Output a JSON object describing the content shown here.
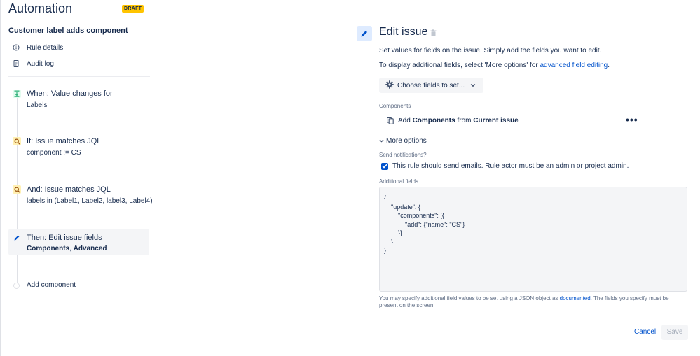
{
  "app": {
    "title": "Automation",
    "badge": "DRAFT"
  },
  "sidebar": {
    "rule_name": "Customer label adds component",
    "links": [
      {
        "label": "Rule details",
        "icon": "info-icon"
      },
      {
        "label": "Audit log",
        "icon": "document-icon"
      }
    ],
    "steps": [
      {
        "line1": "When: Value changes for",
        "line2": "Labels",
        "icon": "trigger-icon",
        "color": "#36b37e"
      },
      {
        "line1": "If: Issue matches JQL",
        "line2": "component != CS",
        "icon": "search-icon",
        "color": "#ffc400"
      },
      {
        "line1": "And: Issue matches JQL",
        "line2": "labels in (Label1, Label2, label3, Label4)",
        "icon": "search-icon",
        "color": "#ffc400"
      },
      {
        "line1": "Then: Edit issue fields",
        "line2_a": "Components",
        "line2_sep": ", ",
        "line2_b": "Advanced",
        "icon": "edit-icon",
        "color": "#0052cc"
      }
    ],
    "add_component": "Add component"
  },
  "main": {
    "title": "Edit issue",
    "desc1": "Set values for fields on the issue. Simply add the fields you want to edit.",
    "desc2_prefix": "To display additional fields, select 'More options' for ",
    "desc2_link": "advanced field editing",
    "desc2_suffix": ".",
    "choose_button": "Choose fields to set...",
    "components_label": "Components",
    "component_row": {
      "add": "Add",
      "field": "Components",
      "from": "from",
      "source": "Current issue"
    },
    "more_options": "More options",
    "send_notifications_label": "Send notifications?",
    "send_notifications_text": "This rule should send emails. Rule actor must be an admin or project admin.",
    "send_notifications_checked": true,
    "additional_fields_label": "Additional fields",
    "additional_fields_value": "{\n    \"update\": {\n        \"components\": [{\n            \"add\": {\"name\": \"CS\"}\n        }]\n    }\n}",
    "help_prefix": "You may specify additional field values to be set using a JSON object as ",
    "help_link": "documented",
    "help_suffix": ". The fields you specify must be present on the screen.",
    "cancel_label": "Cancel",
    "save_label": "Save"
  },
  "colors": {
    "primary": "#0052cc",
    "badge": "#ffc400",
    "trigger": "#36b37e",
    "condition": "#ffc400"
  }
}
